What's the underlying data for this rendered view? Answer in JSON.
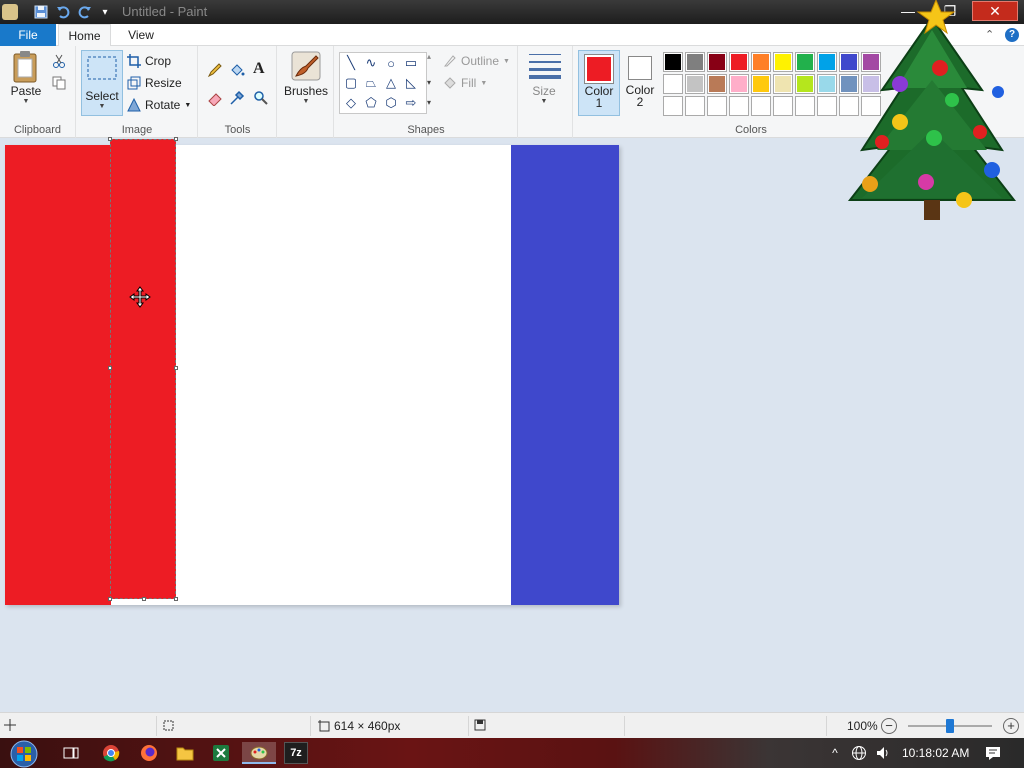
{
  "window": {
    "title": "Untitled - Paint",
    "minimize": "—",
    "maximize": "❐",
    "close": "✕"
  },
  "quick_access": {
    "save": "save-icon",
    "undo": "undo-icon",
    "redo": "redo-icon",
    "customize": "▾"
  },
  "tabs": {
    "file": "File",
    "home": "Home",
    "view": "View"
  },
  "ribbon": {
    "clipboard": {
      "label": "Clipboard",
      "paste": "Paste"
    },
    "image": {
      "label": "Image",
      "select": "Select",
      "crop": "Crop",
      "resize": "Resize",
      "rotate": "Rotate"
    },
    "tools": {
      "label": "Tools"
    },
    "brushes": {
      "label": "Brushes"
    },
    "shapes": {
      "label": "Shapes",
      "outline": "Outline",
      "fill": "Fill"
    },
    "size": {
      "label": "Size"
    },
    "color1": {
      "label": "Color",
      "num": "1",
      "value": "#ed1c24"
    },
    "color2": {
      "label": "Color",
      "num": "2",
      "value": "#ffffff"
    },
    "colors": {
      "label": "Colors",
      "row1": [
        "#000000",
        "#7f7f7f",
        "#880015",
        "#ed1c24",
        "#ff7f27",
        "#fff200",
        "#22b14c",
        "#00a2e8",
        "#3f48cc",
        "#a349a4"
      ],
      "row2": [
        "#ffffff",
        "#c3c3c3",
        "#b97a57",
        "#ffaec9",
        "#ffc90e",
        "#efe4b0",
        "#b5e61d",
        "#99d9ea",
        "#7092be",
        "#c8bfe7"
      ],
      "row3": [
        "#ffffff",
        "#ffffff",
        "#ffffff",
        "#ffffff",
        "#ffffff",
        "#ffffff",
        "#ffffff",
        "#ffffff",
        "#ffffff",
        "#ffffff"
      ]
    }
  },
  "canvas": {
    "stripe_left": "#ed1c24",
    "stripe_right": "#3f48cc",
    "background": "#ffffff"
  },
  "statusbar": {
    "dimensions": "614 × 460px",
    "zoom": "100%",
    "zoom_out": "−",
    "zoom_in": "+"
  },
  "taskbar": {
    "time": "10:18:02 AM",
    "apps": [
      "start-icon",
      "task-view-icon",
      "chrome-icon",
      "firefox-icon",
      "file-explorer-icon",
      "excel-icon",
      "paint-icon",
      "7zip-icon"
    ],
    "sevenzip_label": "7z"
  }
}
